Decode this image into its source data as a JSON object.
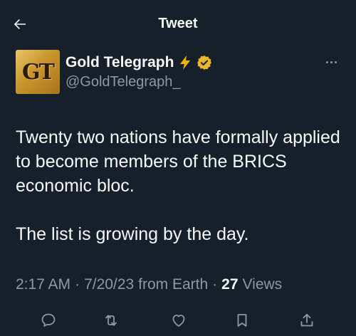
{
  "header": {
    "title": "Tweet",
    "back_icon": "arrow-left-icon"
  },
  "author": {
    "name": "Gold Telegraph",
    "handle": "@GoldTelegraph_",
    "avatar_text": "GT",
    "emoji": "⚡",
    "verified_icon": "verified-badge-gold-icon",
    "verified_color": "#e8b829"
  },
  "tweet": {
    "paragraphs": [
      "Twenty two nations have formally applied to become members of the BRICS economic bloc.",
      "The list is growing by the day."
    ]
  },
  "meta": {
    "time": "2:17 AM",
    "date": "7/20/23",
    "source": "from Earth",
    "views_count": "27",
    "views_label": "Views"
  },
  "actions": [
    "reply-icon",
    "retweet-icon",
    "like-icon",
    "bookmark-icon",
    "share-icon"
  ],
  "colors": {
    "background": "#15202b",
    "primary_text": "#f7f9f9",
    "secondary_text": "#8b98a5"
  }
}
